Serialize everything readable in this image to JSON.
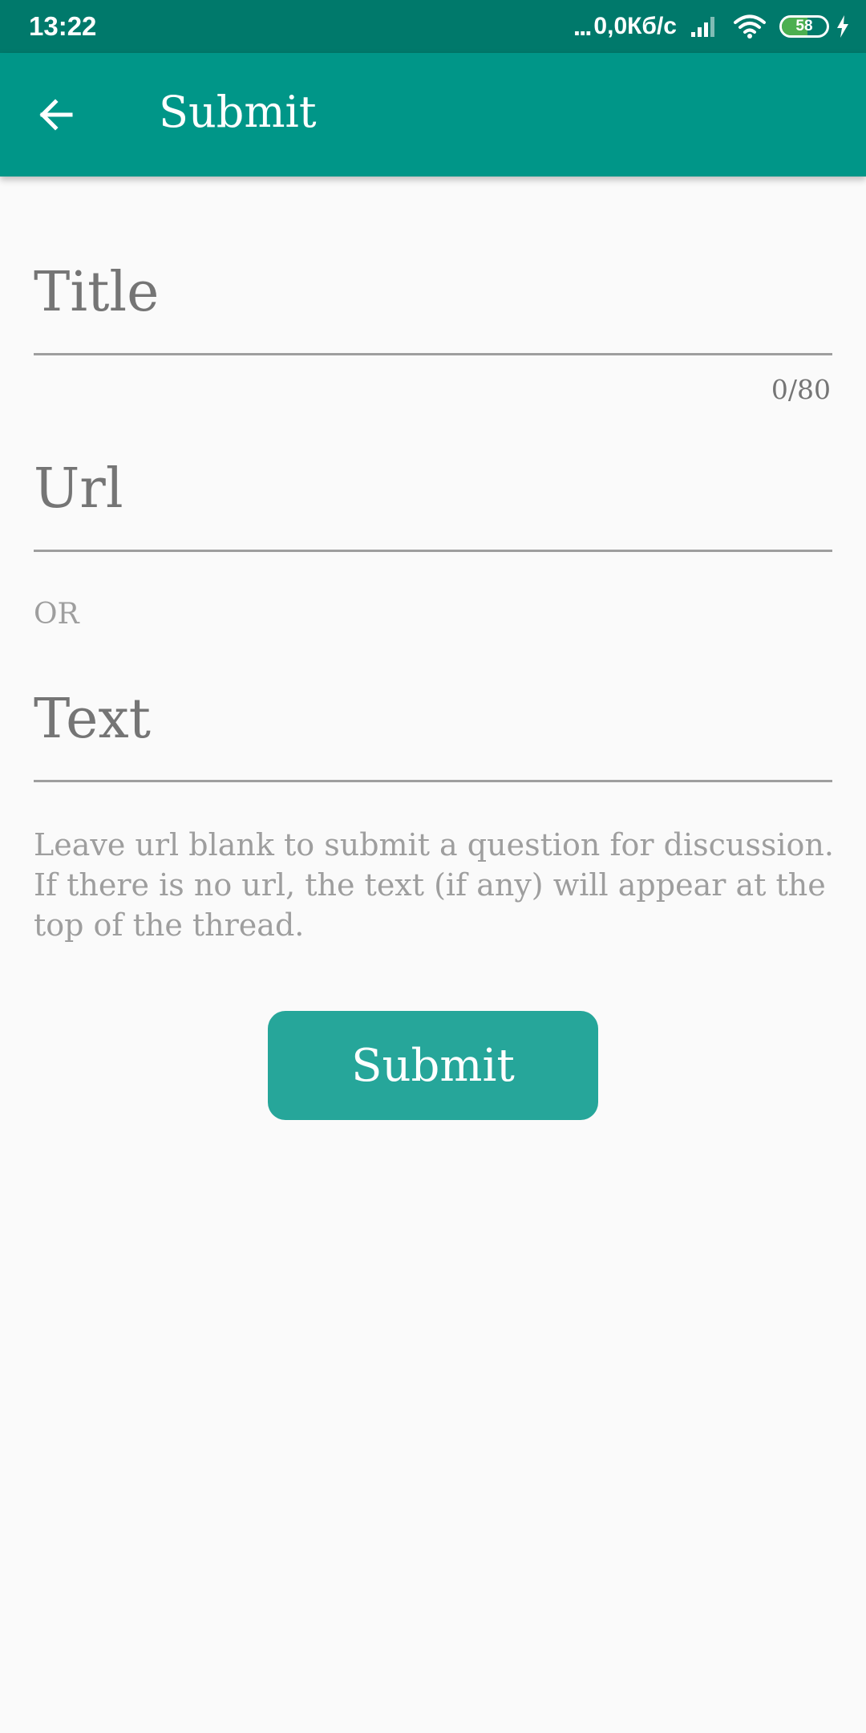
{
  "status_bar": {
    "time": "13:22",
    "dots": "...",
    "network_speed": "0,0Кб/с",
    "battery_level": "58",
    "battery_fraction": 0.58,
    "icons": [
      "signal-icon",
      "wifi-icon",
      "battery-icon",
      "charging-icon"
    ]
  },
  "app_bar": {
    "title": "Submit",
    "back_icon": "arrow-back-icon",
    "background_color": "#009688"
  },
  "form": {
    "title_placeholder": "Title",
    "title_value": "",
    "title_counter": "0/80",
    "url_placeholder": "Url",
    "url_value": "",
    "or_label": "OR",
    "text_placeholder": "Text",
    "text_value": "",
    "hint": "Leave url blank to submit a question for discussion. If there is no url, the text (if any) will appear at the top of the thread.",
    "submit_label": "Submit",
    "submit_color": "#26a69a"
  }
}
